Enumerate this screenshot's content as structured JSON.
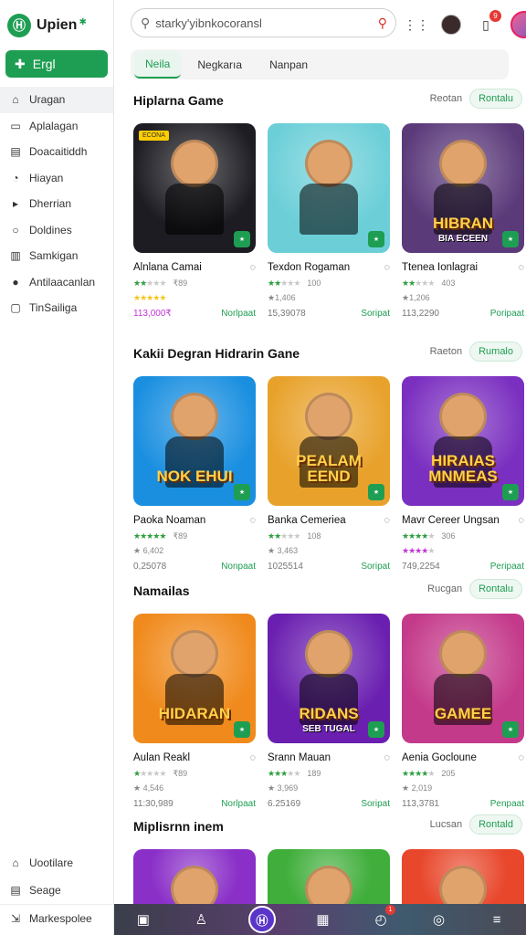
{
  "brand": {
    "name": "Upien",
    "logo": "Ⓗ"
  },
  "sidebar": {
    "primary_button": "Ergl",
    "items": [
      {
        "label": "Uragan",
        "icon": "home-icon",
        "glyph": "⌂",
        "active": true
      },
      {
        "label": "Aplalagan",
        "icon": "document-icon",
        "glyph": "▭"
      },
      {
        "label": "Doacaitiddh",
        "icon": "store-icon",
        "glyph": "▤"
      },
      {
        "label": "Hiayan",
        "icon": "clock-icon",
        "glyph": "◔"
      },
      {
        "label": "Dherrian",
        "icon": "play-icon",
        "glyph": "▸"
      },
      {
        "label": "Doldines",
        "icon": "circle-icon",
        "glyph": "○"
      },
      {
        "label": "Samkigan",
        "icon": "chart-icon",
        "glyph": "▥"
      },
      {
        "label": "Antilaacanlan",
        "icon": "avatar-icon",
        "glyph": "●"
      },
      {
        "label": "TinSailiga",
        "icon": "message-icon",
        "glyph": "▢"
      }
    ],
    "bottom_items": [
      {
        "label": "Uootilare",
        "icon": "bag-icon",
        "glyph": "⌂"
      },
      {
        "label": "Seage",
        "icon": "list-icon",
        "glyph": "▤"
      },
      {
        "label": "Markespolee",
        "icon": "exit-icon",
        "glyph": "⇲"
      }
    ]
  },
  "search": {
    "placeholder": "starky'yibnkocoransl"
  },
  "tabs": [
    {
      "label": "Neila",
      "active": true
    },
    {
      "label": "Negkarıa"
    },
    {
      "label": "Nanpan"
    }
  ],
  "sections": [
    {
      "title": "Hiplarna Game",
      "link": "Reotan",
      "chip": "Rontalu",
      "cards": [
        {
          "title": "Alnlana Camai",
          "meta": "₹89",
          "stars": 2,
          "star_color": "green",
          "stars2": 5,
          "stars2_color": "yellow",
          "price": "113,000₹",
          "price_style": "pink",
          "status": "Norlpaat",
          "bg": "#1c1c22",
          "tag": "ECONA",
          "headline": "",
          "subline": ""
        },
        {
          "title": "Texdon Rogaman",
          "meta": "100",
          "stars": 2,
          "star_color": "green",
          "stars2": 0,
          "price": "15,39078",
          "price_style": "",
          "status": "Soripat",
          "sub": "★1,406",
          "bg": "#6ccfd8",
          "headline": "",
          "subline": ""
        },
        {
          "title": "Ttenea Ionlagrai",
          "meta": "403",
          "stars": 2,
          "star_color": "green",
          "stars2": 0,
          "price": "113,2290",
          "price_style": "",
          "status": "Poripaat",
          "sub": "★1,206",
          "bg": "#5b3a7a",
          "headline": "HIBRAN",
          "subline": "BIA ECEEN"
        }
      ]
    },
    {
      "title": "Kakii Degran Hidrarin Gane",
      "link": "Raeton",
      "chip": "Rumalo",
      "cards": [
        {
          "title": "Paoka Noaman",
          "meta": "₹89",
          "stars": 5,
          "star_color": "green",
          "stars2": 0,
          "price": "0,25078",
          "price_style": "",
          "status": "Nonpaat",
          "sub": "★ 6,402",
          "bg": "#1a8fe0",
          "headline": "NOK EHUI",
          "subline": ""
        },
        {
          "title": "Banka Cemeriea",
          "meta": "108",
          "stars": 2,
          "star_color": "green",
          "stars2": 0,
          "price": "1025514",
          "price_style": "",
          "status": "Soripat",
          "sub": "★ 3,463",
          "bg": "#e8a22b",
          "headline": "PEALAM EEND",
          "subline": ""
        },
        {
          "title": "Mavr Cereer Ungsan",
          "meta": "306",
          "stars": 4,
          "star_color": "green",
          "stars2": 4,
          "stars2_color": "purple",
          "price": "749,2254",
          "price_style": "",
          "status": "Peripaat",
          "bg": "#7a2fc0",
          "headline": "HIRAIAS MNMEAS",
          "subline": ""
        }
      ]
    },
    {
      "title": "Namailas",
      "link": "Rucgan",
      "chip": "Rontalu",
      "cards": [
        {
          "title": "Aulan Reakl",
          "meta": "₹89",
          "stars": 1,
          "star_color": "green",
          "stars2": 0,
          "price": "11:30,989",
          "price_style": "",
          "status": "Norlpaat",
          "sub": "★ 4,546",
          "bg": "#f08a1c",
          "headline": "HIDARAN",
          "subline": ""
        },
        {
          "title": "Srann Mauan",
          "meta": "189",
          "stars": 3,
          "star_color": "green",
          "stars2": 0,
          "price": "6.25169",
          "price_style": "",
          "status": "Soripat",
          "sub": "★ 3,969",
          "bg": "#6a1fb0",
          "headline": "RIDANS",
          "subline": "SEB TUGAL"
        },
        {
          "title": "Aenia Gocloune",
          "meta": "205",
          "stars": 4,
          "star_color": "green",
          "stars2": 0,
          "price": "113,3781",
          "price_style": "",
          "status": "Penpaat",
          "sub": "★ 2,019",
          "bg": "#c43a8a",
          "headline": "GAMEE",
          "subline": ""
        }
      ]
    },
    {
      "title": "Miplisrnn inem",
      "link": "Lucsan",
      "chip": "Rontald",
      "cards": [
        {
          "bg": "#8a2fc8"
        },
        {
          "bg": "#3fae3a"
        },
        {
          "bg": "#e8472c"
        }
      ]
    }
  ],
  "bottom_nav": [
    {
      "icon": "window-icon",
      "glyph": "▣"
    },
    {
      "icon": "user-icon",
      "glyph": "♙"
    },
    {
      "icon": "logo-icon",
      "glyph": "Ⓗ"
    },
    {
      "icon": "store-icon",
      "glyph": "▦"
    },
    {
      "icon": "alarm-icon",
      "glyph": "◴",
      "badge": "1"
    },
    {
      "icon": "gamepad-icon",
      "glyph": "◎"
    },
    {
      "icon": "menu-icon",
      "glyph": "≡"
    }
  ]
}
